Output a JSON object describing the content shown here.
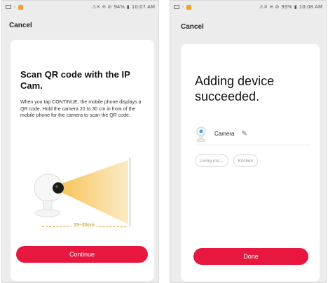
{
  "left_screen": {
    "status_bar": {
      "left_icons": [
        "gallery-icon",
        "location-icon",
        "notification-icon"
      ],
      "right_text": "94%",
      "time": "10:07 AM",
      "right_prefix": "⚠✕ ≋ ⊘"
    },
    "cancel_label": "Cancel",
    "title": "Scan QR code with the IP Cam.",
    "description": "When you tap CONTINUE, the mobile phone displays a QR code. Hold the camera 20 to 30 cm in front of the mobile phone for the camera to scan the QR code.",
    "distance_label": "15~20cm",
    "continue_label": "Continue"
  },
  "right_screen": {
    "status_bar": {
      "left_icons": [
        "gallery-icon",
        "location-icon",
        "notification-icon"
      ],
      "right_text": "93%",
      "time": "10:08 AM",
      "right_prefix": "⚠✕ ≋ ⊘"
    },
    "cancel_label": "Cancel",
    "title": "Adding device succeeded.",
    "device_name": "Camera",
    "rooms": [
      "Living roo...",
      "Kitchen"
    ],
    "done_label": "Done"
  },
  "colors": {
    "accent": "#e8173f",
    "beam": "#f6c55b",
    "distance": "#d9a635"
  }
}
